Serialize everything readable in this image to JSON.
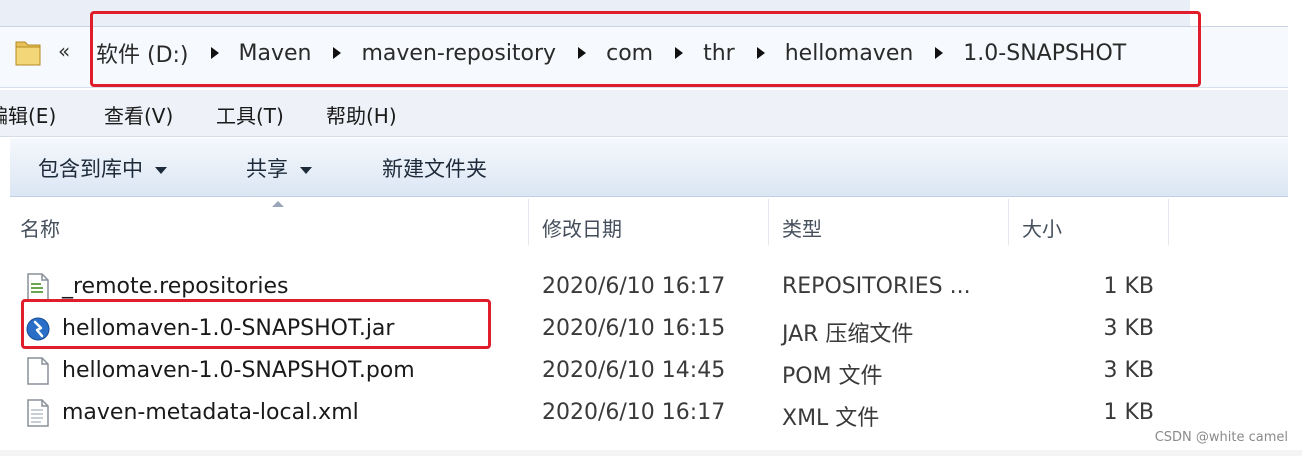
{
  "address": {
    "overflow_glyph": "«",
    "crumbs": [
      "软件 (D:)",
      "Maven",
      "maven-repository",
      "com",
      "thr",
      "hellomaven",
      "1.0-SNAPSHOT"
    ],
    "highlight_color": "#e01e2b"
  },
  "menu": {
    "edit": "编辑(E)",
    "view": "查看(V)",
    "tools": "工具(T)",
    "help": "帮助(H)"
  },
  "toolbar": {
    "include_library": "包含到库中",
    "share": "共享",
    "new_folder": "新建文件夹"
  },
  "columns": {
    "name": "名称",
    "modified": "修改日期",
    "type": "类型",
    "size": "大小"
  },
  "files": [
    {
      "icon": "text-document-icon",
      "name": "_remote.repositories",
      "modified": "2020/6/10 16:17",
      "type": "REPOSITORIES ...",
      "size": "1 KB"
    },
    {
      "icon": "jar-file-icon",
      "name": "hellomaven-1.0-SNAPSHOT.jar",
      "modified": "2020/6/10 16:15",
      "type": "JAR 压缩文件",
      "size": "3 KB"
    },
    {
      "icon": "blank-file-icon",
      "name": "hellomaven-1.0-SNAPSHOT.pom",
      "modified": "2020/6/10 14:45",
      "type": "POM 文件",
      "size": "3 KB"
    },
    {
      "icon": "xml-file-icon",
      "name": "maven-metadata-local.xml",
      "modified": "2020/6/10 16:17",
      "type": "XML 文件",
      "size": "1 KB"
    }
  ],
  "watermark": "CSDN @white camel"
}
